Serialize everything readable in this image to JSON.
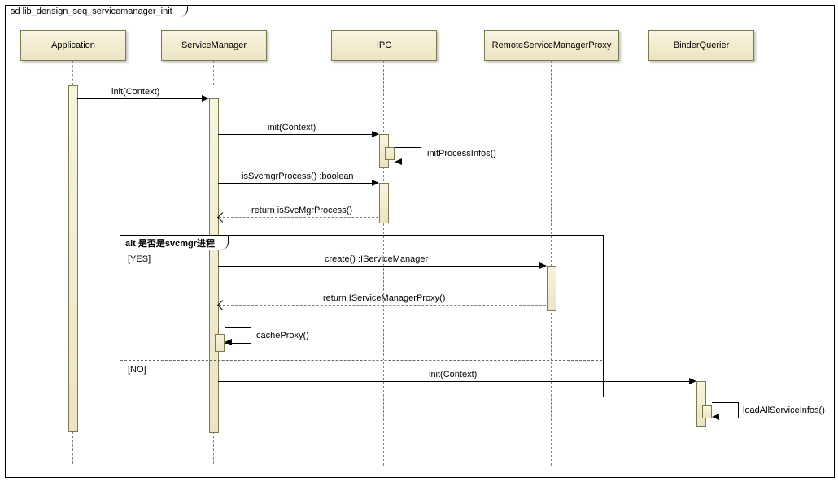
{
  "diagram_title": "sd lib_densign_seq_servicemanager_init",
  "lifelines": {
    "application": "Application",
    "servicemanager": "ServiceManager",
    "ipc": "IPC",
    "remoteproxy": "RemoteServiceManagerProxy",
    "binderquerier": "BinderQuerier"
  },
  "messages": {
    "m1": "init(Context)",
    "m2": "init(Context)",
    "m3": "initProcessInfos()",
    "m4": "isSvcmgrProcess() :boolean",
    "m5": "return isSvcMgrProcess()",
    "m6": "create() :IServiceManager",
    "m7": "return IServiceManagerProxy()",
    "m8": "cacheProxy()",
    "m9": "init(Context)",
    "m10": "loadAllServiceInfos()"
  },
  "fragment": {
    "label": "alt 是否是svcmgr进程",
    "guard_yes": "[YES]",
    "guard_no": "[NO]"
  },
  "chart_data": {
    "type": "sequence-diagram",
    "title": "sd lib_densign_seq_servicemanager_init",
    "lifelines": [
      "Application",
      "ServiceManager",
      "IPC",
      "RemoteServiceManagerProxy",
      "BinderQuerier"
    ],
    "messages": [
      {
        "from": "Application",
        "to": "ServiceManager",
        "label": "init(Context)",
        "kind": "sync"
      },
      {
        "from": "ServiceManager",
        "to": "IPC",
        "label": "init(Context)",
        "kind": "sync"
      },
      {
        "from": "IPC",
        "to": "IPC",
        "label": "initProcessInfos()",
        "kind": "self"
      },
      {
        "from": "ServiceManager",
        "to": "IPC",
        "label": "isSvcmgrProcess() :boolean",
        "kind": "sync"
      },
      {
        "from": "IPC",
        "to": "ServiceManager",
        "label": "return isSvcMgrProcess()",
        "kind": "return"
      },
      {
        "from": "ServiceManager",
        "to": "RemoteServiceManagerProxy",
        "label": "create() :IServiceManager",
        "kind": "sync",
        "fragment": "alt",
        "guard": "YES"
      },
      {
        "from": "RemoteServiceManagerProxy",
        "to": "ServiceManager",
        "label": "return IServiceManagerProxy()",
        "kind": "return",
        "fragment": "alt",
        "guard": "YES"
      },
      {
        "from": "ServiceManager",
        "to": "ServiceManager",
        "label": "cacheProxy()",
        "kind": "self",
        "fragment": "alt",
        "guard": "YES"
      },
      {
        "from": "ServiceManager",
        "to": "BinderQuerier",
        "label": "init(Context)",
        "kind": "sync",
        "fragment": "alt",
        "guard": "NO"
      },
      {
        "from": "BinderQuerier",
        "to": "BinderQuerier",
        "label": "loadAllServiceInfos()",
        "kind": "self"
      }
    ],
    "fragments": [
      {
        "type": "alt",
        "label": "是否是svcmgr进程",
        "operands": [
          "YES",
          "NO"
        ]
      }
    ]
  }
}
